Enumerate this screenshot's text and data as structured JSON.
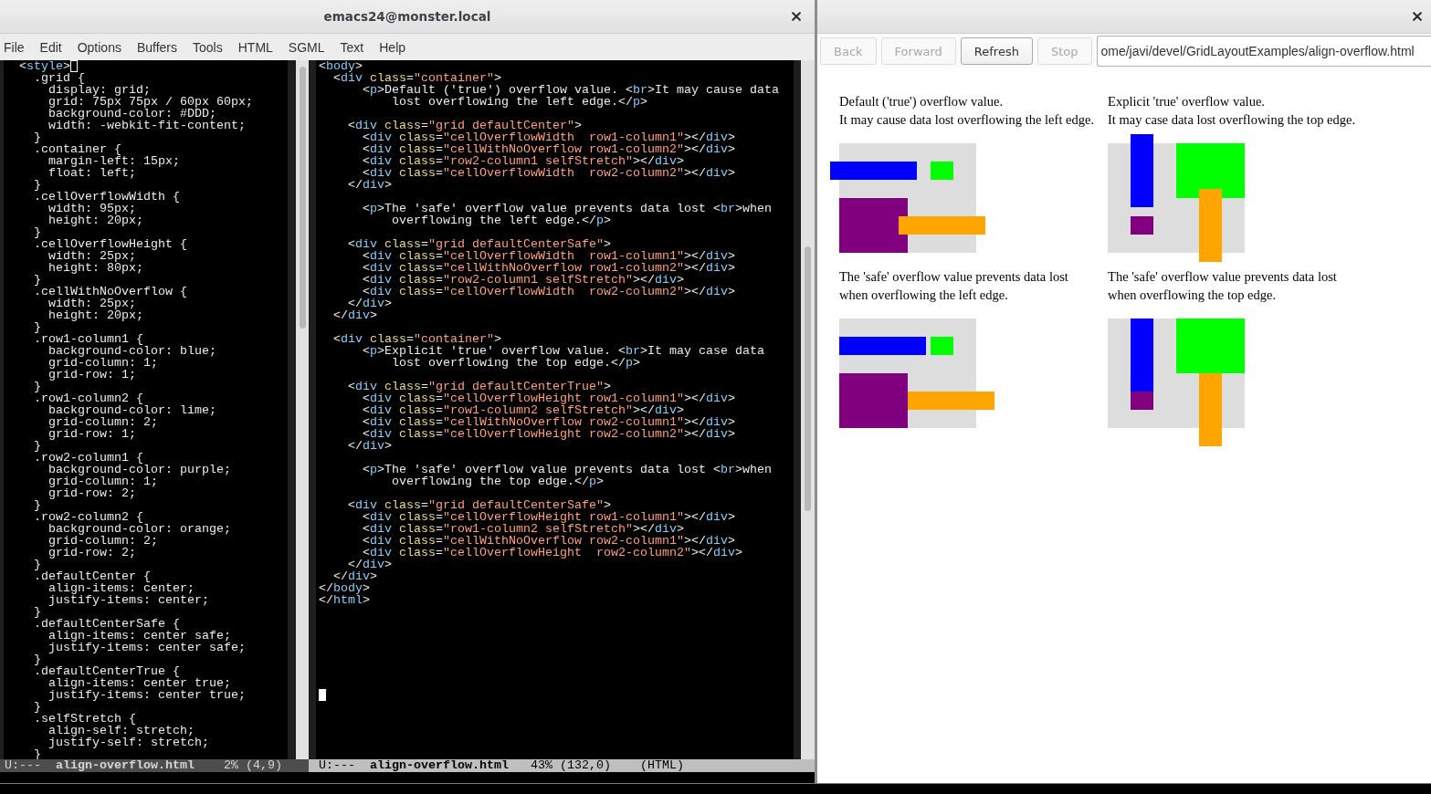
{
  "emacs": {
    "title": "emacs24@monster.local",
    "menu": [
      "File",
      "Edit",
      "Options",
      "Buffers",
      "Tools",
      "HTML",
      "SGML",
      "Text",
      "Help"
    ],
    "windows": [
      {
        "active": false,
        "mode_line": {
          "status": "U:---",
          "buffer": "align-overflow.html",
          "percent": "2%",
          "position": "(4,9)"
        },
        "lines": [
          {
            "text": "  <style>",
            "cursor": true
          },
          {
            "text": "    .grid {",
            "cursor": false
          },
          {
            "text": "      display: grid;",
            "cursor": false
          },
          {
            "text": "      grid: 75px 75px / 60px 60px;",
            "cursor": false
          },
          {
            "text": "      background-color: #DDD;",
            "cursor": false
          },
          {
            "text": "      width: -webkit-fit-content;",
            "cursor": false
          },
          {
            "text": "    }",
            "cursor": false
          },
          {
            "text": "    .container {",
            "cursor": false
          },
          {
            "text": "      margin-left: 15px;",
            "cursor": false
          },
          {
            "text": "      float: left;",
            "cursor": false
          },
          {
            "text": "    }",
            "cursor": false
          },
          {
            "text": "    .cellOverflowWidth {",
            "cursor": false
          },
          {
            "text": "      width: 95px;",
            "cursor": false
          },
          {
            "text": "      height: 20px;",
            "cursor": false
          },
          {
            "text": "    }",
            "cursor": false
          },
          {
            "text": "    .cellOverflowHeight {",
            "cursor": false
          },
          {
            "text": "      width: 25px;",
            "cursor": false
          },
          {
            "text": "      height: 80px;",
            "cursor": false
          },
          {
            "text": "    }",
            "cursor": false
          },
          {
            "text": "    .cellWithNoOverflow {",
            "cursor": false
          },
          {
            "text": "      width: 25px;",
            "cursor": false
          },
          {
            "text": "      height: 20px;",
            "cursor": false
          },
          {
            "text": "    }",
            "cursor": false
          },
          {
            "text": "    .row1-column1 {",
            "cursor": false
          },
          {
            "text": "      background-color: blue;",
            "cursor": false
          },
          {
            "text": "      grid-column: 1;",
            "cursor": false
          },
          {
            "text": "      grid-row: 1;",
            "cursor": false
          },
          {
            "text": "    }",
            "cursor": false
          },
          {
            "text": "    .row1-column2 {",
            "cursor": false
          },
          {
            "text": "      background-color: lime;",
            "cursor": false
          },
          {
            "text": "      grid-column: 2;",
            "cursor": false
          },
          {
            "text": "      grid-row: 1;",
            "cursor": false
          },
          {
            "text": "    }",
            "cursor": false
          },
          {
            "text": "    .row2-column1 {",
            "cursor": false
          },
          {
            "text": "      background-color: purple;",
            "cursor": false
          },
          {
            "text": "      grid-column: 1;",
            "cursor": false
          },
          {
            "text": "      grid-row: 2;",
            "cursor": false
          },
          {
            "text": "    }",
            "cursor": false
          },
          {
            "text": "    .row2-column2 {",
            "cursor": false
          },
          {
            "text": "      background-color: orange;",
            "cursor": false
          },
          {
            "text": "      grid-column: 2;",
            "cursor": false
          },
          {
            "text": "      grid-row: 2;",
            "cursor": false
          },
          {
            "text": "    }",
            "cursor": false
          },
          {
            "text": "    .defaultCenter {",
            "cursor": false
          },
          {
            "text": "      align-items: center;",
            "cursor": false
          },
          {
            "text": "      justify-items: center;",
            "cursor": false
          },
          {
            "text": "    }",
            "cursor": false
          },
          {
            "text": "    .defaultCenterSafe {",
            "cursor": false
          },
          {
            "text": "      align-items: center safe;",
            "cursor": false
          },
          {
            "text": "      justify-items: center safe;",
            "cursor": false
          },
          {
            "text": "    }",
            "cursor": false
          },
          {
            "text": "    .defaultCenterTrue {",
            "cursor": false
          },
          {
            "text": "      align-items: center true;",
            "cursor": false
          },
          {
            "text": "      justify-items: center true;",
            "cursor": false
          },
          {
            "text": "    }",
            "cursor": false
          },
          {
            "text": "    .selfStretch {",
            "cursor": false
          },
          {
            "text": "      align-self: stretch;",
            "cursor": false
          },
          {
            "text": "      justify-self: stretch;",
            "cursor": false
          },
          {
            "text": "    }",
            "cursor": false
          }
        ]
      },
      {
        "active": true,
        "mode_line": {
          "status": "U:---",
          "buffer": "align-overflow.html",
          "percent": "43%",
          "position": "(132,0)",
          "mode": "(HTML)"
        },
        "lines": [
          {
            "text": "<body>",
            "cursor": false
          },
          {
            "text": "  <div class=\"container\">",
            "cursor": false
          },
          {
            "text": "      <p>Default ('true') overflow value. <br>It may cause data",
            "cursor": false
          },
          {
            "text": "          lost overflowing the left edge.</p>",
            "cursor": false
          },
          {
            "cursor": false
          },
          {
            "text": "    <div class=\"grid defaultCenter\">",
            "cursor": false
          },
          {
            "text": "      <div class=\"cellOverflowWidth  row1-column1\"></div>",
            "cursor": false
          },
          {
            "text": "      <div class=\"cellWithNoOverflow row1-column2\"></div>",
            "cursor": false
          },
          {
            "text": "      <div class=\"row2-column1 selfStretch\"></div>",
            "cursor": false
          },
          {
            "text": "      <div class=\"cellOverflowWidth  row2-column2\"></div>",
            "cursor": false
          },
          {
            "text": "    </div>",
            "cursor": false
          },
          {
            "cursor": false
          },
          {
            "text": "      <p>The 'safe' overflow value prevents data lost <br>when",
            "cursor": false
          },
          {
            "text": "          overflowing the left edge.</p>",
            "cursor": false
          },
          {
            "cursor": false
          },
          {
            "text": "    <div class=\"grid defaultCenterSafe\">",
            "cursor": false
          },
          {
            "text": "      <div class=\"cellOverflowWidth  row1-column1\"></div>",
            "cursor": false
          },
          {
            "text": "      <div class=\"cellWithNoOverflow row1-column2\"></div>",
            "cursor": false
          },
          {
            "text": "      <div class=\"row2-column1 selfStretch\"></div>",
            "cursor": false
          },
          {
            "text": "      <div class=\"cellOverflowWidth  row2-column2\"></div>",
            "cursor": false
          },
          {
            "text": "    </div>",
            "cursor": false
          },
          {
            "text": "  </div>",
            "cursor": false
          },
          {
            "cursor": false
          },
          {
            "text": "  <div class=\"container\">",
            "cursor": false
          },
          {
            "text": "      <p>Explicit 'true' overflow value. <br>It may case data",
            "cursor": false
          },
          {
            "text": "          lost overflowing the top edge.</p>",
            "cursor": false
          },
          {
            "cursor": false
          },
          {
            "text": "    <div class=\"grid defaultCenterTrue\">",
            "cursor": false
          },
          {
            "text": "      <div class=\"cellOverflowHeight row1-column1\"></div>",
            "cursor": false
          },
          {
            "text": "      <div class=\"row1-column2 selfStretch\"></div>",
            "cursor": false
          },
          {
            "text": "      <div class=\"cellWithNoOverflow row2-column1\"></div>",
            "cursor": false
          },
          {
            "text": "      <div class=\"cellOverflowHeight row2-column2\"></div>",
            "cursor": false
          },
          {
            "text": "    </div>",
            "cursor": false
          },
          {
            "cursor": false
          },
          {
            "text": "      <p>The 'safe' overflow value prevents data lost <br>when",
            "cursor": false
          },
          {
            "text": "          overflowing the top edge.</p>",
            "cursor": false
          },
          {
            "cursor": false
          },
          {
            "text": "    <div class=\"grid defaultCenterSafe\">",
            "cursor": false
          },
          {
            "text": "      <div class=\"cellOverflowHeight row1-column1\"></div>",
            "cursor": false
          },
          {
            "text": "      <div class=\"row1-column2 selfStretch\"></div>",
            "cursor": false
          },
          {
            "text": "      <div class=\"cellWithNoOverflow row2-column1\"></div>",
            "cursor": false
          },
          {
            "text": "      <div class=\"cellOverflowHeight  row2-column2\"></div>",
            "cursor": false
          },
          {
            "text": "    </div>",
            "cursor": false
          },
          {
            "text": "  </div>",
            "cursor": false
          },
          {
            "text": "</body>",
            "cursor": false
          },
          {
            "text": "</html>",
            "cursor": false
          },
          {
            "cursor": false
          },
          {
            "cursor": false
          },
          {
            "cursor": false
          },
          {
            "cursor": false
          },
          {
            "cursor": false
          },
          {
            "cursor": false
          },
          {
            "cursor": false
          },
          {
            "cursor": true
          }
        ]
      }
    ]
  },
  "browser": {
    "toolbar": [
      {
        "label": "Back",
        "disabled": true
      },
      {
        "label": "Forward",
        "disabled": true
      },
      {
        "label": "Refresh",
        "disabled": false
      },
      {
        "label": "Stop",
        "disabled": true
      }
    ],
    "address": "ome/javi/devel/GridLayoutExamples/align-overflow.html",
    "page": {
      "containers": [
        {
          "sections": [
            {
              "lines": [
                "Default ('true') overflow value.",
                "It may cause data lost overflowing the left edge."
              ],
              "grid": {
                "items": [
                  {
                    "color": "#0000ff"
                  },
                  {
                    "color": "#00ff00"
                  },
                  {
                    "color": "#800080"
                  },
                  {
                    "color": "#ffa500"
                  }
                ]
              }
            },
            {
              "lines": [
                "The 'safe' overflow value prevents data lost",
                "when overflowing the left edge."
              ],
              "grid": {
                "items": [
                  {
                    "color": "#0000ff"
                  },
                  {
                    "color": "#00ff00"
                  },
                  {
                    "color": "#800080"
                  },
                  {
                    "color": "#ffa500"
                  }
                ]
              }
            }
          ]
        },
        {
          "sections": [
            {
              "lines": [
                "Explicit 'true' overflow value.",
                "It may case data lost overflowing the top edge."
              ],
              "grid": {
                "items": [
                  {
                    "color": "#0000ff"
                  },
                  {
                    "color": "#00ff00"
                  },
                  {
                    "color": "#800080"
                  },
                  {
                    "color": "#ffa500"
                  }
                ]
              }
            },
            {
              "lines": [
                "The 'safe' overflow value prevents data lost",
                "when overflowing the top edge."
              ],
              "grid": {
                "items": [
                  {
                    "color": "#0000ff"
                  },
                  {
                    "color": "#00ff00"
                  },
                  {
                    "color": "#800080"
                  },
                  {
                    "color": "#ffa500"
                  }
                ]
              }
            }
          ]
        }
      ]
    }
  }
}
